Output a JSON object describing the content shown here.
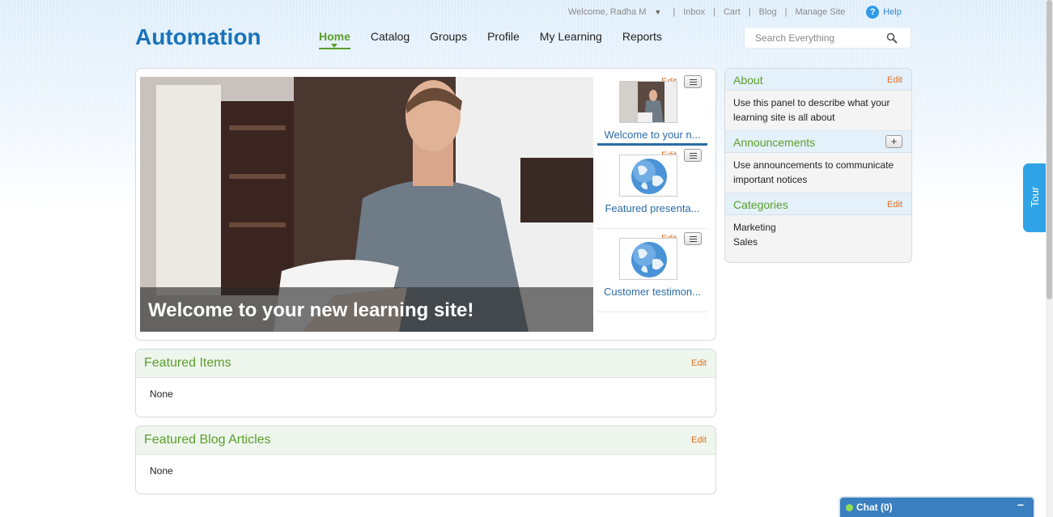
{
  "util": {
    "welcome": "Welcome, Radha M",
    "links": [
      "Inbox",
      "Cart",
      "Blog",
      "Manage Site"
    ],
    "help": "Help"
  },
  "logo": "Automation",
  "nav": [
    "Home",
    "Catalog",
    "Groups",
    "Profile",
    "My Learning",
    "Reports"
  ],
  "search": {
    "placeholder": "Search Everything"
  },
  "feature": {
    "hero_caption": "Welcome to your new learning site!",
    "thumbs": [
      {
        "title": "Welcome to your n...",
        "edit": "Edit"
      },
      {
        "title": "Featured presenta...",
        "edit": "Edit"
      },
      {
        "title": "Customer testimon...",
        "edit": "Edit"
      }
    ]
  },
  "featured_items": {
    "title": "Featured Items",
    "edit": "Edit",
    "body": "None"
  },
  "featured_blog": {
    "title": "Featured Blog Articles",
    "edit": "Edit",
    "body": "None"
  },
  "sidebar": {
    "about": {
      "title": "About",
      "edit": "Edit",
      "body": "Use this panel to describe what your learning site is all about"
    },
    "announcements": {
      "title": "Announcements",
      "add": "+",
      "body": "Use announcements to communicate important notices"
    },
    "categories": {
      "title": "Categories",
      "edit": "Edit",
      "items": [
        "Marketing",
        "Sales"
      ]
    }
  },
  "tour": "Tour",
  "chat": {
    "label": "Chat  (0)",
    "minimize": "−"
  }
}
